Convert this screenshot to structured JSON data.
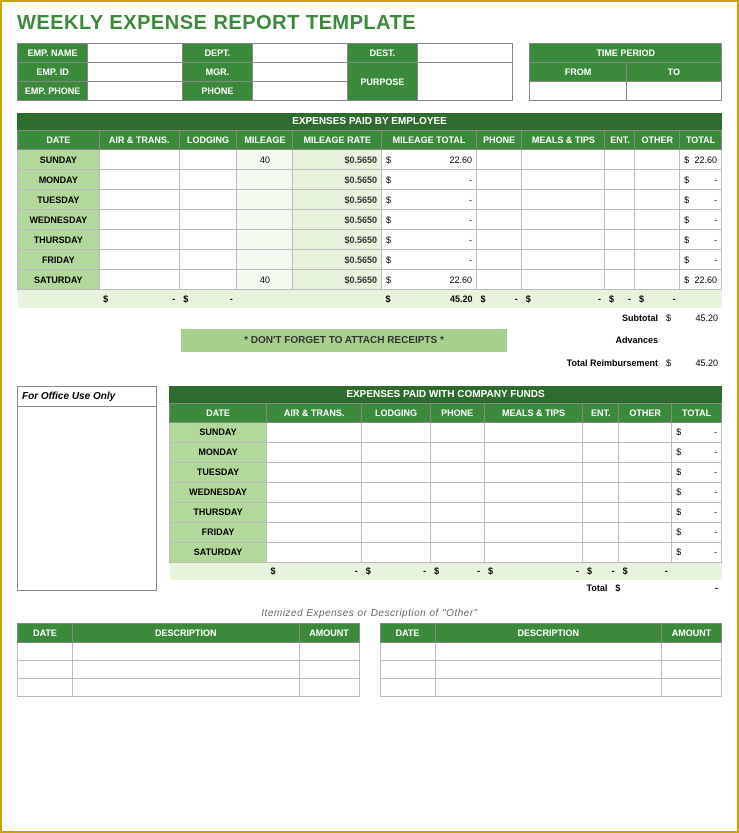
{
  "title": "WEEKLY EXPENSE REPORT TEMPLATE",
  "header": {
    "emp_name": "EMP. NAME",
    "emp_id": "EMP. ID",
    "emp_phone": "EMP. PHONE",
    "dept": "DEPT.",
    "mgr": "MGR.",
    "phone": "PHONE",
    "dest": "DEST.",
    "purpose": "PURPOSE",
    "time_period": "TIME PERIOD",
    "from": "FROM",
    "to": "TO"
  },
  "emp_section": {
    "title": "EXPENSES PAID BY EMPLOYEE",
    "cols": [
      "DATE",
      "AIR & TRANS.",
      "LODGING",
      "MILEAGE",
      "MILEAGE RATE",
      "MILEAGE TOTAL",
      "PHONE",
      "MEALS & TIPS",
      "ENT.",
      "OTHER",
      "TOTAL"
    ],
    "rows": [
      {
        "day": "SUNDAY",
        "mileage": "40",
        "rate": "$0.5650",
        "mtotal": "22.60",
        "total": "22.60"
      },
      {
        "day": "MONDAY",
        "mileage": "",
        "rate": "$0.5650",
        "mtotal": "-",
        "total": "-"
      },
      {
        "day": "TUESDAY",
        "mileage": "",
        "rate": "$0.5650",
        "mtotal": "-",
        "total": "-"
      },
      {
        "day": "WEDNESDAY",
        "mileage": "",
        "rate": "$0.5650",
        "mtotal": "-",
        "total": "-"
      },
      {
        "day": "THURSDAY",
        "mileage": "",
        "rate": "$0.5650",
        "mtotal": "-",
        "total": "-"
      },
      {
        "day": "FRIDAY",
        "mileage": "",
        "rate": "$0.5650",
        "mtotal": "-",
        "total": "-"
      },
      {
        "day": "SATURDAY",
        "mileage": "40",
        "rate": "$0.5650",
        "mtotal": "22.60",
        "total": "22.60"
      }
    ],
    "sums": {
      "air": "-",
      "lodging": "-",
      "mtotal": "45.20",
      "phone": "-",
      "meals": "-",
      "ent": "-",
      "other": "-"
    },
    "subtotal_lbl": "Subtotal",
    "subtotal": "45.20",
    "advances_lbl": "Advances",
    "advances": "",
    "reimb_lbl": "Total Reimbursement",
    "reimb": "45.20",
    "receipts": "* DON'T FORGET TO ATTACH RECEIPTS *"
  },
  "office": "For Office Use Only",
  "comp_section": {
    "title": "EXPENSES PAID WITH COMPANY FUNDS",
    "cols": [
      "DATE",
      "AIR & TRANS.",
      "LODGING",
      "PHONE",
      "MEALS & TIPS",
      "ENT.",
      "OTHER",
      "TOTAL"
    ],
    "rows": [
      {
        "day": "SUNDAY",
        "total": "-"
      },
      {
        "day": "MONDAY",
        "total": "-"
      },
      {
        "day": "TUESDAY",
        "total": "-"
      },
      {
        "day": "WEDNESDAY",
        "total": "-"
      },
      {
        "day": "THURSDAY",
        "total": "-"
      },
      {
        "day": "FRIDAY",
        "total": "-"
      },
      {
        "day": "SATURDAY",
        "total": "-"
      }
    ],
    "sums": {
      "air": "-",
      "lodging": "-",
      "phone": "-",
      "meals": "-",
      "ent": "-",
      "other": "-"
    },
    "total_lbl": "Total",
    "total": "-"
  },
  "itemized": {
    "title": "Itemized Expenses or Description of \"Other\"",
    "cols": [
      "DATE",
      "DESCRIPTION",
      "AMOUNT"
    ]
  }
}
